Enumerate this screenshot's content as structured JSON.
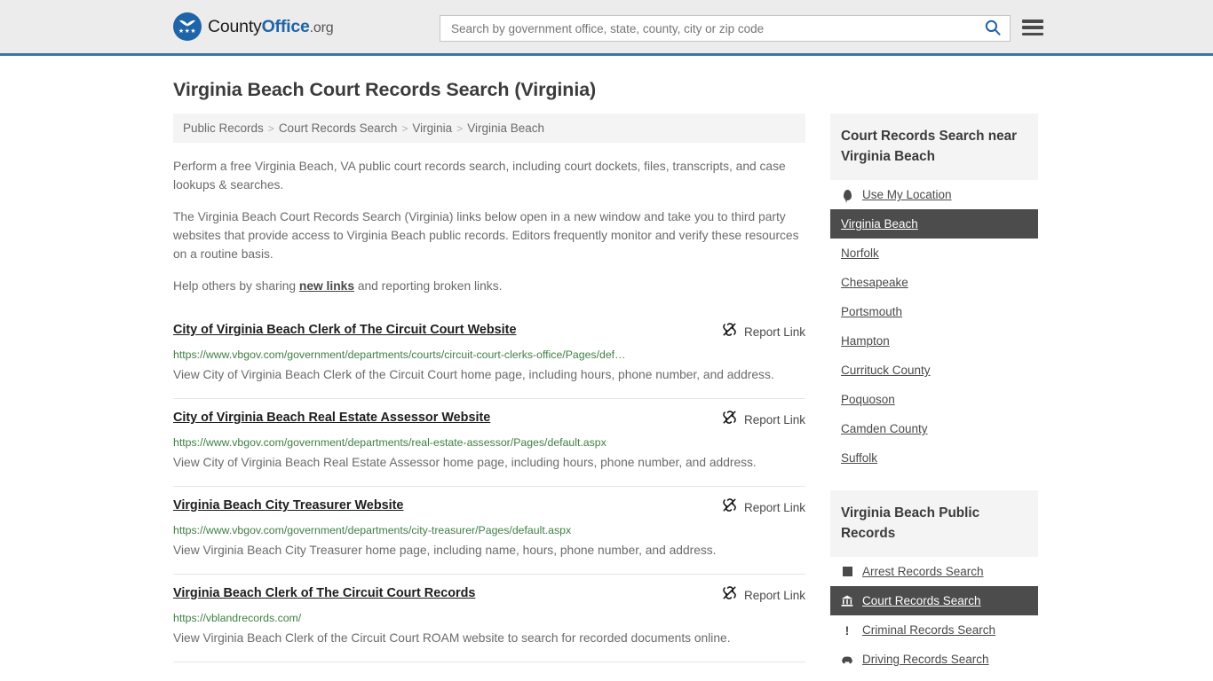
{
  "header": {
    "logo": {
      "part1": "County",
      "part2": "Office",
      "part3": ".org",
      "icon": "eagle-seal-icon",
      "stars": "★★★"
    },
    "search": {
      "placeholder": "Search by government office, state, county, city or zip code",
      "value": "",
      "icon": "search-icon",
      "accent": "#1f64a8"
    },
    "menu_icon": "hamburger-menu-icon",
    "border_color": "#3a75a8",
    "background": "#ececec"
  },
  "page": {
    "title": "Virginia Beach Court Records Search (Virginia)"
  },
  "breadcrumb": {
    "separator": ">",
    "items": [
      {
        "label": "Public Records"
      },
      {
        "label": "Court Records Search"
      },
      {
        "label": "Virginia"
      },
      {
        "label": "Virginia Beach"
      }
    ]
  },
  "intro": {
    "p1": "Perform a free Virginia Beach, VA public court records search, including court dockets, files, transcripts, and case lookups & searches.",
    "p2": "The Virginia Beach Court Records Search (Virginia) links below open in a new window and take you to third party websites that provide access to Virginia Beach public records. Editors frequently monitor and verify these resources on a routine basis.",
    "p3_before": "Help others by sharing ",
    "p3_link": "new links",
    "p3_after": " and reporting broken links."
  },
  "results": {
    "report_label": "Report Link",
    "report_icon": "broken-link-icon",
    "items": [
      {
        "title": "City of Virginia Beach Clerk of The Circuit Court Website",
        "url": "https://www.vbgov.com/government/departments/courts/circuit-court-clerks-office/Pages/def…",
        "description": "View City of Virginia Beach Clerk of the Circuit Court home page, including hours, phone number, and address."
      },
      {
        "title": "City of Virginia Beach Real Estate Assessor Website",
        "url": "https://www.vbgov.com/government/departments/real-estate-assessor/Pages/default.aspx",
        "description": "View City of Virginia Beach Real Estate Assessor home page, including hours, phone number, and address."
      },
      {
        "title": "Virginia Beach City Treasurer Website",
        "url": "https://www.vbgov.com/government/departments/city-treasurer/Pages/default.aspx",
        "description": "View Virginia Beach City Treasurer home page, including name, hours, phone number, and address."
      },
      {
        "title": "Virginia Beach Clerk of The Circuit Court Records",
        "url": "https://vblandrecords.com/",
        "description": "View Virginia Beach Clerk of the Circuit Court ROAM website to search for recorded documents online."
      }
    ]
  },
  "sidebar": {
    "nearby": {
      "title": "Court Records Search near Virginia Beach",
      "items": [
        {
          "label": "Use My Location",
          "icon": "location-pin-icon",
          "active": false
        },
        {
          "label": "Virginia Beach",
          "icon": "",
          "active": true
        },
        {
          "label": "Norfolk",
          "icon": "",
          "active": false
        },
        {
          "label": "Chesapeake",
          "icon": "",
          "active": false
        },
        {
          "label": "Portsmouth",
          "icon": "",
          "active": false
        },
        {
          "label": "Hampton",
          "icon": "",
          "active": false
        },
        {
          "label": "Currituck County",
          "icon": "",
          "active": false
        },
        {
          "label": "Poquoson",
          "icon": "",
          "active": false
        },
        {
          "label": "Camden County",
          "icon": "",
          "active": false
        },
        {
          "label": "Suffolk",
          "icon": "",
          "active": false
        }
      ]
    },
    "public_records": {
      "title": "Virginia Beach Public Records",
      "items": [
        {
          "label": "Arrest Records Search",
          "icon": "fingerprint-icon",
          "active": false
        },
        {
          "label": "Court Records Search",
          "icon": "courthouse-icon",
          "active": true
        },
        {
          "label": "Criminal Records Search",
          "icon": "exclamation-icon",
          "active": false
        },
        {
          "label": "Driving Records Search",
          "icon": "car-icon",
          "active": false
        }
      ]
    },
    "active_background": "#4c4c4c",
    "panel_background": "#f4f4f4"
  }
}
